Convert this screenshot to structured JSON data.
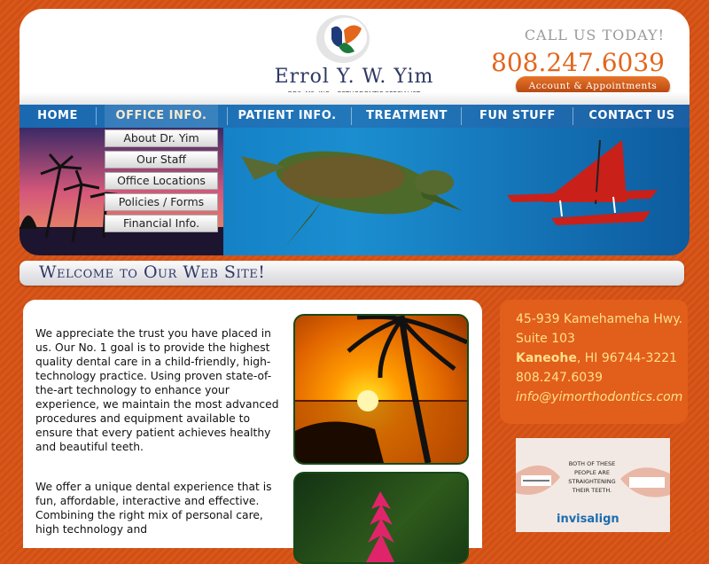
{
  "header": {
    "brand_name": "Errol Y. W. Yim",
    "brand_sub": "DDS, MS, INC  •  ORTHODONTIC SPECIALIST",
    "call_label": "CALL US TODAY!",
    "phone": "808.247.6039",
    "account_button": "Account & Appointments"
  },
  "nav": {
    "items": [
      "HOME",
      "OFFICE INFO.",
      "PATIENT INFO.",
      "TREATMENT",
      "FUN STUFF",
      "CONTACT US"
    ],
    "active": "OFFICE INFO.",
    "dropdown": [
      "About Dr. Yim",
      "Our Staff",
      "Office Locations",
      "Policies / Forms",
      "Financial Info."
    ]
  },
  "welcome_title": "Welcome to Our Web Site!",
  "main": {
    "paragraph1": "We appreciate the trust you have placed in us. Our No. 1 goal is to provide the highest quality dental care in a child-friendly, high-technology practice. Using proven state-of-the-art technology to enhance your experience, we maintain the most advanced procedures and equipment available to ensure that every patient achieves healthy and beautiful teeth.",
    "paragraph2": "We offer a unique dental experience that is fun, affordable, interactive and effective. Combining the right mix of personal care, high technology and"
  },
  "address": {
    "street": "45-939 Kamehameha Hwy.",
    "suite": "Suite 103",
    "city": "Kaneohe",
    "state_zip": ", HI 96744-3221",
    "phone": "808.247.6039",
    "email": "info@yimorthodontics.com"
  },
  "ad": {
    "text": "BOTH OF THESE PEOPLE ARE STRAIGHTENING THEIR TEETH.",
    "brand": "invisalign"
  },
  "colors": {
    "accent_orange": "#e2661c",
    "navy": "#2f3864",
    "address_text": "#ffe08a"
  }
}
